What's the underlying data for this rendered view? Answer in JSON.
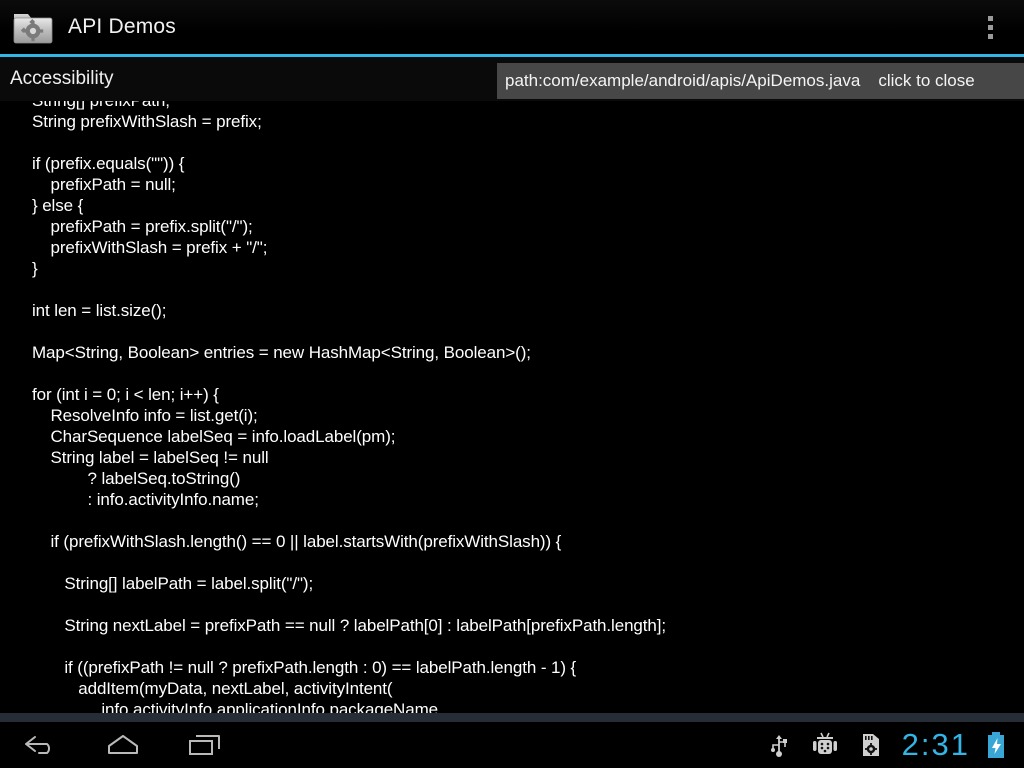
{
  "action_bar": {
    "app_icon": "folder-gear-icon",
    "title": "API Demos",
    "overflow_icon": "overflow-menu-icon"
  },
  "accent_color": "#33b5e5",
  "sub_header": {
    "title": "Accessibility"
  },
  "path_overlay": {
    "path_text": "path:com/example/android/apis/ApiDemos.java",
    "close_label": "click to close",
    "background_color": "#474747"
  },
  "code_view": {
    "text_color": "#ffffff",
    "background_color": "#000000",
    "lines": [
      "String[] prefixPath;",
      "String prefixWithSlash = prefix;",
      "",
      "if (prefix.equals(\"\")) {",
      "    prefixPath = null;",
      "} else {",
      "    prefixPath = prefix.split(\"/\");",
      "    prefixWithSlash = prefix + \"/\";",
      "}",
      "",
      "int len = list.size();",
      "",
      "Map<String, Boolean> entries = new HashMap<String, Boolean>();",
      "",
      "for (int i = 0; i < len; i++) {",
      "    ResolveInfo info = list.get(i);",
      "    CharSequence labelSeq = info.loadLabel(pm);",
      "    String label = labelSeq != null",
      "            ? labelSeq.toString()",
      "            : info.activityInfo.name;",
      "",
      "    if (prefixWithSlash.length() == 0 || label.startsWith(prefixWithSlash)) {",
      "",
      "       String[] labelPath = label.split(\"/\");",
      "",
      "       String nextLabel = prefixPath == null ? labelPath[0] : labelPath[prefixPath.length];",
      "",
      "       if ((prefixPath != null ? prefixPath.length : 0) == labelPath.length - 1) {",
      "          addItem(myData, nextLabel, activityIntent(",
      "               info.activityInfo.applicationInfo.packageName,"
    ]
  },
  "nav_bar": {
    "back_icon": "back-arrow-icon",
    "home_icon": "home-icon",
    "recents_icon": "recent-apps-icon",
    "status_icons": [
      "usb-icon",
      "android-debug-icon",
      "sd-card-icon"
    ],
    "clock": "2:31",
    "clock_color": "#33b5e5",
    "battery_icon": "battery-charging-icon"
  }
}
